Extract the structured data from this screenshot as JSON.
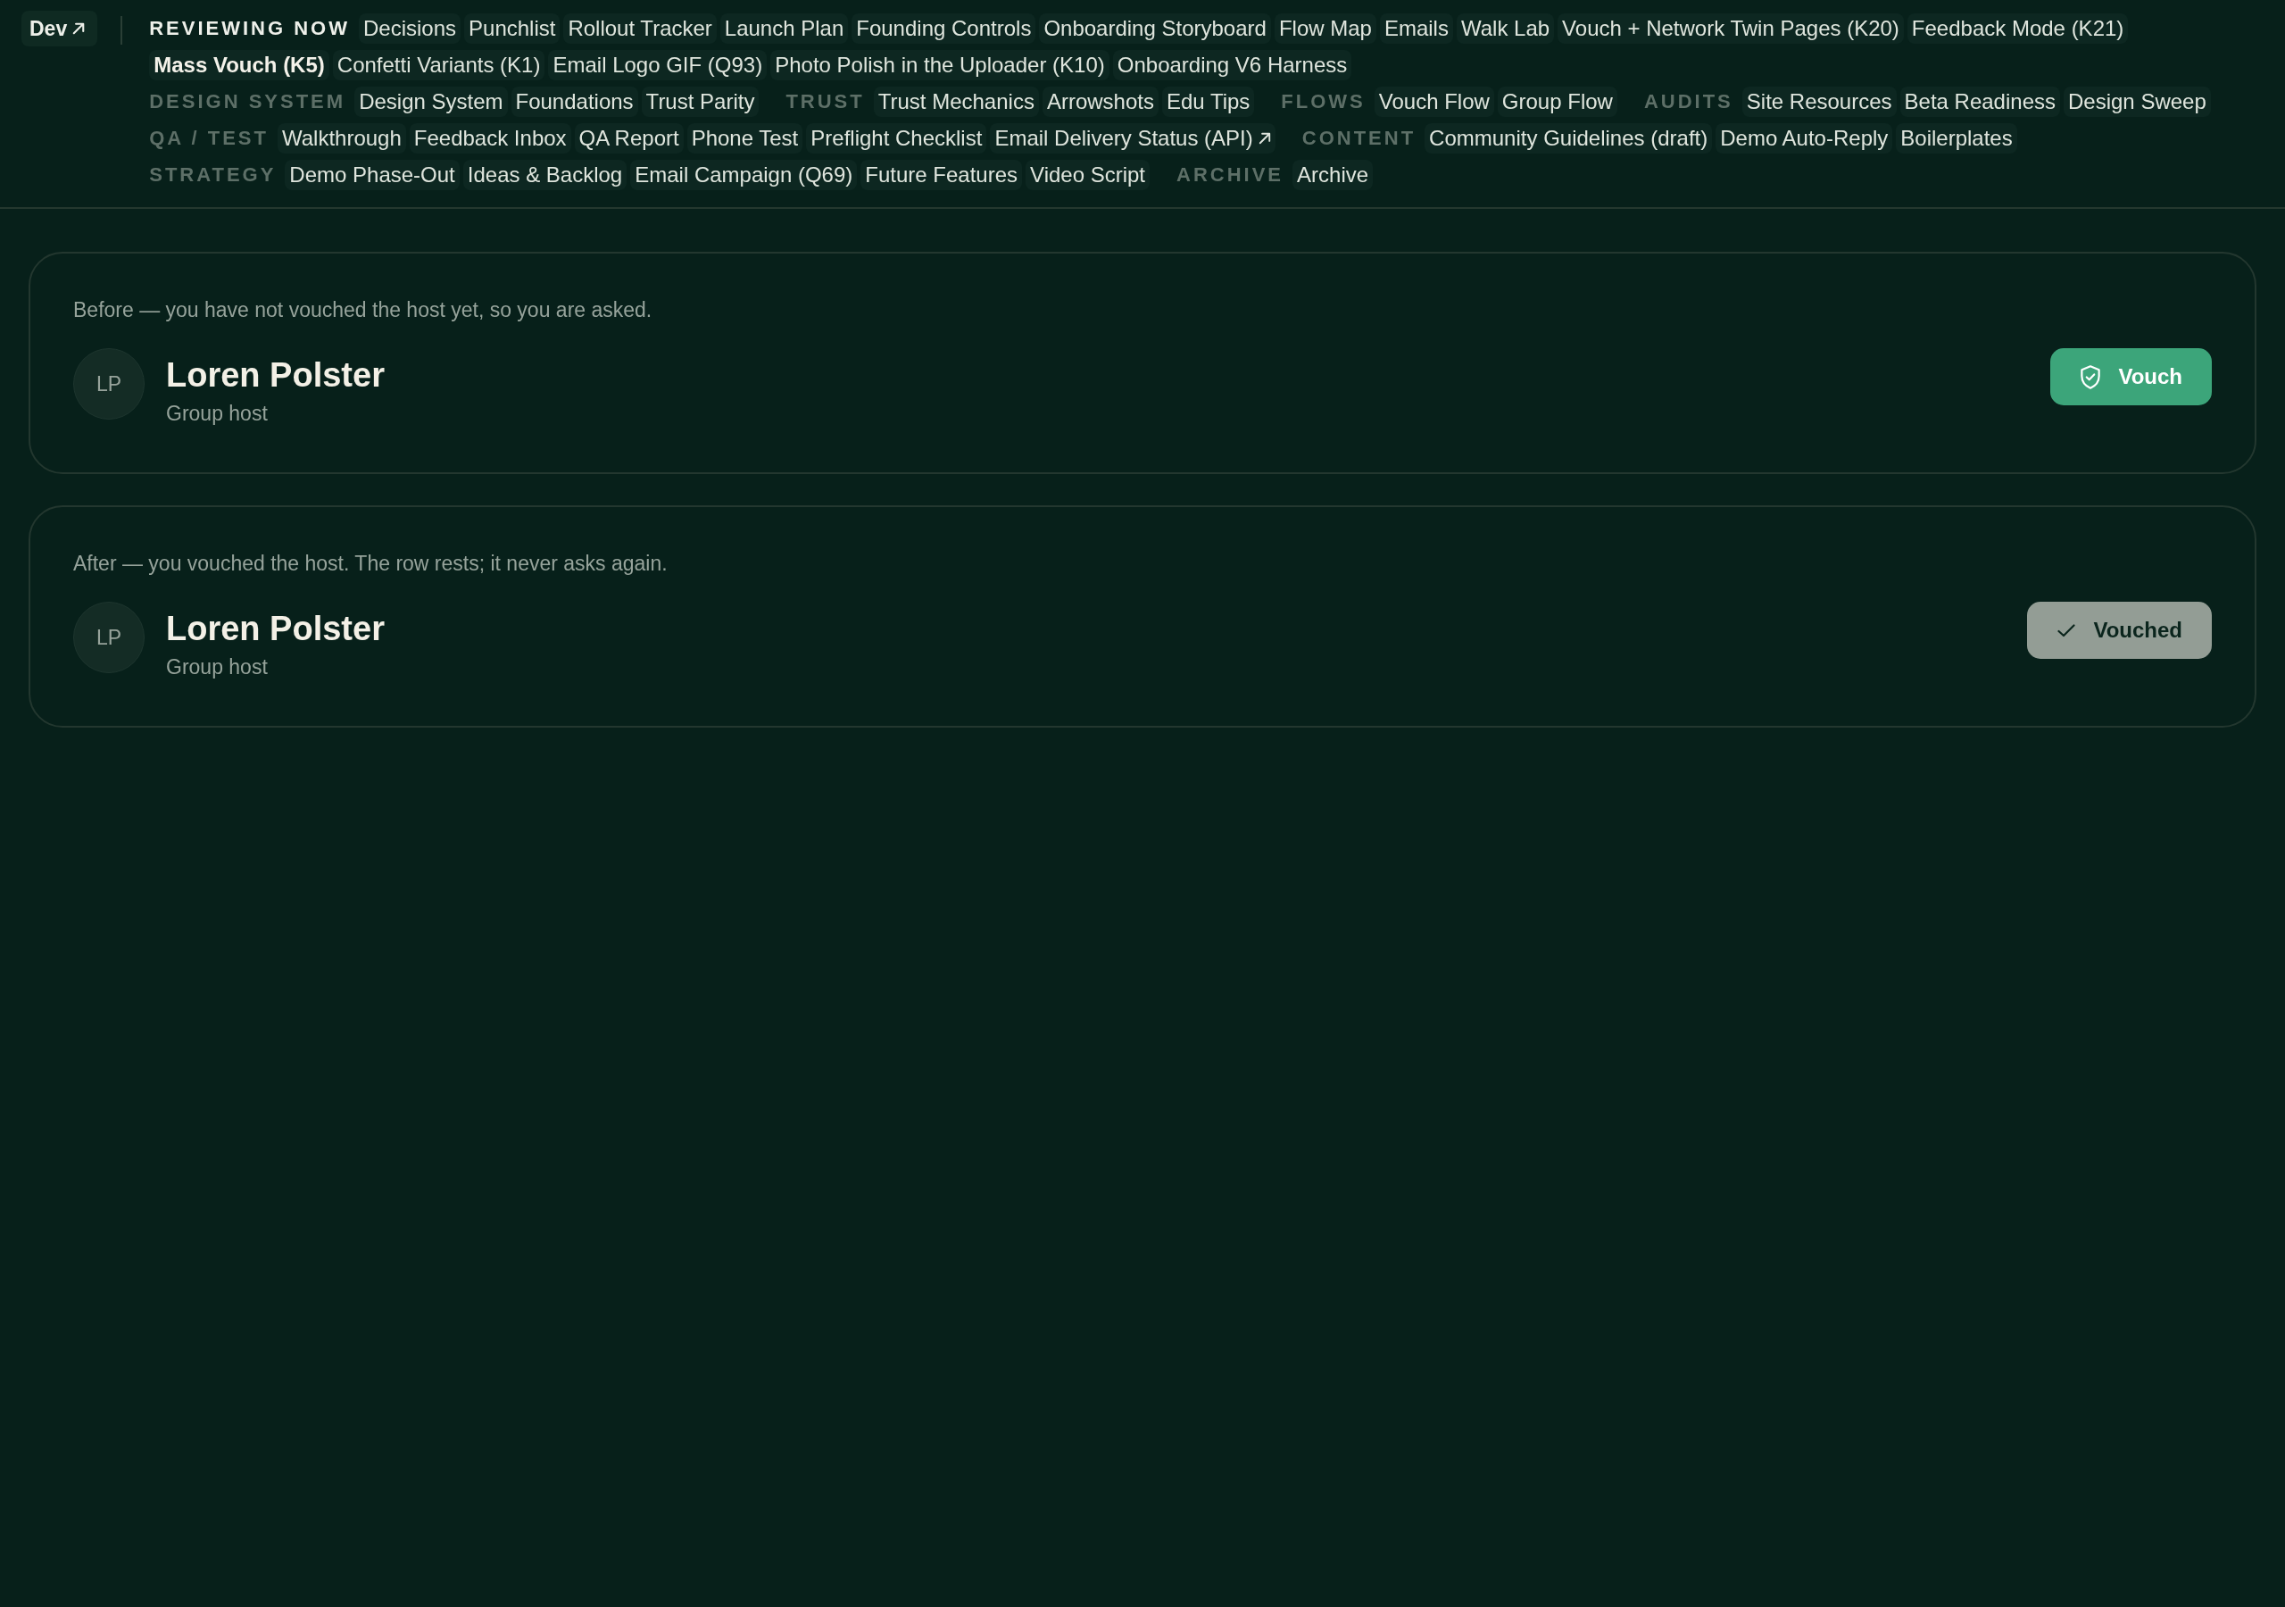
{
  "nav": {
    "dev_link": {
      "label": "Dev",
      "external": true
    },
    "rows": [
      [
        {
          "label": "REVIEWING NOW",
          "items": [
            {
              "label": "Decisions",
              "selected": false,
              "external": false
            },
            {
              "label": "Punchlist",
              "selected": false,
              "external": false
            },
            {
              "label": "Rollout Tracker",
              "selected": false,
              "external": false
            },
            {
              "label": "Launch Plan",
              "selected": false,
              "external": false
            },
            {
              "label": "Founding Controls",
              "selected": false,
              "external": false
            },
            {
              "label": "Onboarding Storyboard",
              "selected": false,
              "external": false
            },
            {
              "label": "Flow Map",
              "selected": false,
              "external": false
            },
            {
              "label": "Emails",
              "selected": false,
              "external": false
            },
            {
              "label": "Walk Lab",
              "selected": false,
              "external": false
            },
            {
              "label": "Vouch + Network Twin Pages (K20)",
              "selected": false,
              "external": false
            },
            {
              "label": "Feedback Mode (K21)",
              "selected": false,
              "external": false
            },
            {
              "label": "Mass Vouch (K5)",
              "selected": true,
              "external": false
            },
            {
              "label": "Confetti Variants (K1)",
              "selected": false,
              "external": false
            },
            {
              "label": "Email Logo GIF (Q93)",
              "selected": false,
              "external": false
            },
            {
              "label": "Photo Polish in the Uploader (K10)",
              "selected": false,
              "external": false
            },
            {
              "label": "Onboarding V6 Harness",
              "selected": false,
              "external": false
            }
          ]
        }
      ],
      [
        {
          "label": "DESIGN SYSTEM",
          "items": [
            {
              "label": "Design System",
              "selected": false,
              "external": false
            },
            {
              "label": "Foundations",
              "selected": false,
              "external": false
            },
            {
              "label": "Trust Parity",
              "selected": false,
              "external": false
            }
          ]
        },
        {
          "label": "TRUST",
          "items": [
            {
              "label": "Trust Mechanics",
              "selected": false,
              "external": false
            },
            {
              "label": "Arrowshots",
              "selected": false,
              "external": false
            },
            {
              "label": "Edu Tips",
              "selected": false,
              "external": false
            }
          ]
        },
        {
          "label": "FLOWS",
          "items": [
            {
              "label": "Vouch Flow",
              "selected": false,
              "external": false
            },
            {
              "label": "Group Flow",
              "selected": false,
              "external": false
            }
          ]
        },
        {
          "label": "AUDITS",
          "items": [
            {
              "label": "Site Resources",
              "selected": false,
              "external": false
            },
            {
              "label": "Beta Readiness",
              "selected": false,
              "external": false
            },
            {
              "label": "Design Sweep",
              "selected": false,
              "external": false
            }
          ]
        }
      ],
      [
        {
          "label": "QA / TEST",
          "items": [
            {
              "label": "Walkthrough",
              "selected": false,
              "external": false
            },
            {
              "label": "Feedback Inbox",
              "selected": false,
              "external": false
            },
            {
              "label": "QA Report",
              "selected": false,
              "external": false
            },
            {
              "label": "Phone Test",
              "selected": false,
              "external": false
            },
            {
              "label": "Preflight Checklist",
              "selected": false,
              "external": false
            },
            {
              "label": "Email Delivery Status (API)",
              "selected": false,
              "external": true
            }
          ]
        },
        {
          "label": "CONTENT",
          "items": [
            {
              "label": "Community Guidelines (draft)",
              "selected": false,
              "external": false
            },
            {
              "label": "Demo Auto-Reply",
              "selected": false,
              "external": false
            },
            {
              "label": "Boilerplates",
              "selected": false,
              "external": false
            }
          ]
        }
      ],
      [
        {
          "label": "STRATEGY",
          "items": [
            {
              "label": "Demo Phase-Out",
              "selected": false,
              "external": false
            },
            {
              "label": "Ideas & Backlog",
              "selected": false,
              "external": false
            },
            {
              "label": "Email Campaign (Q69)",
              "selected": false,
              "external": false
            },
            {
              "label": "Future Features",
              "selected": false,
              "external": false
            },
            {
              "label": "Video Script",
              "selected": false,
              "external": false
            }
          ]
        },
        {
          "label": "ARCHIVE",
          "items": [
            {
              "label": "Archive",
              "selected": false,
              "external": false
            }
          ]
        }
      ]
    ]
  },
  "cards": [
    {
      "caption": "Before — you have not vouched the host yet, so you are asked.",
      "person": {
        "initials": "LP",
        "name": "Loren Polster",
        "role": "Group host"
      },
      "action": {
        "label": "Vouch",
        "vouched": false
      }
    },
    {
      "caption": "After — you vouched the host. The row rests; it never asks again.",
      "person": {
        "initials": "LP",
        "name": "Loren Polster",
        "role": "Group host"
      },
      "action": {
        "label": "Vouched",
        "vouched": true
      }
    }
  ]
}
